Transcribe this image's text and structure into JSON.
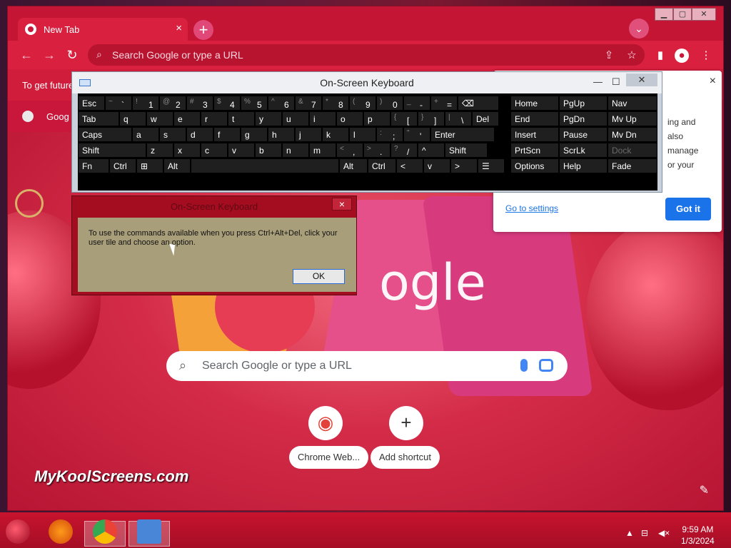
{
  "browser": {
    "tab_title": "New Tab",
    "tab_close": "×",
    "new_tab": "+",
    "omnibox_placeholder": "Search Google or type a URL",
    "infobar_text": "To get future",
    "bookmark_label": "Goog"
  },
  "ntp": {
    "logo_text": "ogle",
    "search_placeholder": "Search Google or type a URL",
    "shortcuts": [
      {
        "label": "Chrome Web...",
        "icon": "chrome-web-store-icon"
      },
      {
        "label": "Add shortcut",
        "icon": "plus-icon"
      }
    ],
    "watermark": "MyKoolScreens.com"
  },
  "popup": {
    "text_lines": [
      "ing and",
      "also",
      "manage",
      "or your"
    ],
    "link": "Go to settings",
    "button": "Got it",
    "close": "×"
  },
  "osk": {
    "title": "On-Screen Keyboard",
    "rows": [
      [
        {
          "k": "Esc"
        },
        {
          "s": "~",
          "k": "`"
        },
        {
          "s": "!",
          "k": "1"
        },
        {
          "s": "@",
          "k": "2"
        },
        {
          "s": "#",
          "k": "3"
        },
        {
          "s": "$",
          "k": "4"
        },
        {
          "s": "%",
          "k": "5"
        },
        {
          "s": "^",
          "k": "6"
        },
        {
          "s": "&",
          "k": "7"
        },
        {
          "s": "*",
          "k": "8"
        },
        {
          "s": "(",
          "k": "9"
        },
        {
          "s": ")",
          "k": "0"
        },
        {
          "s": "_",
          "k": "-"
        },
        {
          "s": "+",
          "k": "="
        },
        {
          "k": "⌫"
        }
      ],
      [
        {
          "k": "Tab"
        },
        {
          "k": "q"
        },
        {
          "k": "w"
        },
        {
          "k": "e"
        },
        {
          "k": "r"
        },
        {
          "k": "t"
        },
        {
          "k": "y"
        },
        {
          "k": "u"
        },
        {
          "k": "i"
        },
        {
          "k": "o"
        },
        {
          "k": "p"
        },
        {
          "s": "{",
          "k": "["
        },
        {
          "s": "}",
          "k": "]"
        },
        {
          "s": "|",
          "k": "\\"
        },
        {
          "k": "Del"
        }
      ],
      [
        {
          "k": "Caps"
        },
        {
          "k": "a"
        },
        {
          "k": "s"
        },
        {
          "k": "d"
        },
        {
          "k": "f"
        },
        {
          "k": "g"
        },
        {
          "k": "h"
        },
        {
          "k": "j"
        },
        {
          "k": "k"
        },
        {
          "k": "l"
        },
        {
          "s": ":",
          "k": ";"
        },
        {
          "s": "\"",
          "k": "'"
        },
        {
          "k": "Enter"
        }
      ],
      [
        {
          "k": "Shift"
        },
        {
          "k": "z"
        },
        {
          "k": "x"
        },
        {
          "k": "c"
        },
        {
          "k": "v"
        },
        {
          "k": "b"
        },
        {
          "k": "n"
        },
        {
          "k": "m"
        },
        {
          "s": "<",
          "k": ","
        },
        {
          "s": ">",
          "k": "."
        },
        {
          "s": "?",
          "k": "/"
        },
        {
          "k": "^"
        },
        {
          "k": "Shift"
        }
      ],
      [
        {
          "k": "Fn"
        },
        {
          "k": "Ctrl"
        },
        {
          "k": "⊞"
        },
        {
          "k": "Alt"
        },
        {
          "k": ""
        },
        {
          "k": "Alt"
        },
        {
          "k": "Ctrl"
        },
        {
          "k": "<"
        },
        {
          "k": "v"
        },
        {
          "k": ">"
        },
        {
          "k": "☰"
        }
      ]
    ],
    "nav_rows": [
      [
        "Home",
        "PgUp",
        "Nav"
      ],
      [
        "End",
        "PgDn",
        "Mv Up"
      ],
      [
        "Insert",
        "Pause",
        "Mv Dn"
      ],
      [
        "PrtScn",
        "ScrLk",
        "Dock"
      ],
      [
        "Options",
        "Help",
        "Fade"
      ]
    ]
  },
  "dialog": {
    "title": "On-Screen Keyboard",
    "message": "To use the commands available when you press Ctrl+Alt+Del, click your user tile and choose an option.",
    "ok": "OK",
    "close": "×"
  },
  "taskbar": {
    "time": "9:59 AM",
    "date": "1/3/2024"
  }
}
